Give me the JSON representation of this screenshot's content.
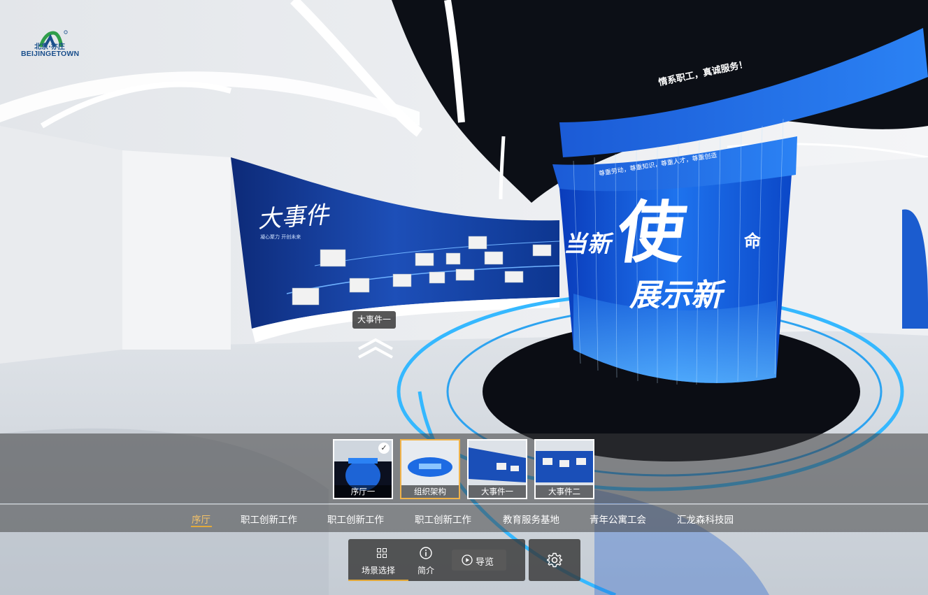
{
  "logo": {
    "cn_text": "北京·亦庄",
    "en_text": "BEIJINGETOWN",
    "icon": "beijing-etown-logo-icon"
  },
  "scene": {
    "poster_title": "大事件",
    "poster_subtitle": "凝心聚力  开创未来",
    "banner_top": "情系职工，真诚服务！",
    "banner_mid": "尊重劳动，尊重知识，尊重人才，尊重创造",
    "cylinder_line1": "当新",
    "cylinder_big": "使",
    "cylinder_small": "命",
    "cylinder_line2": "展示新"
  },
  "hotspot": {
    "label": "大事件一",
    "icon": "double-chevron-up-icon"
  },
  "thumbnails": [
    {
      "label": "序厅一",
      "selected": false,
      "checked": true
    },
    {
      "label": "组织架构",
      "selected": true,
      "checked": false
    },
    {
      "label": "大事件一",
      "selected": false,
      "checked": false
    },
    {
      "label": "大事件二",
      "selected": false,
      "checked": false
    }
  ],
  "tabs": [
    {
      "label": "序厅",
      "active": true
    },
    {
      "label": "职工创新工作",
      "active": false
    },
    {
      "label": "职工创新工作",
      "active": false
    },
    {
      "label": "职工创新工作",
      "active": false
    },
    {
      "label": "教育服务基地",
      "active": false
    },
    {
      "label": "青年公寓工会",
      "active": false
    },
    {
      "label": "汇龙森科技园",
      "active": false
    }
  ],
  "toolbar": {
    "scene_select": {
      "label": "场景选择",
      "icon": "grid-icon"
    },
    "intro": {
      "label": "简介",
      "icon": "info-icon"
    },
    "guide": {
      "label": "导览",
      "icon": "play-circle-icon"
    },
    "settings": {
      "icon": "gear-icon"
    }
  },
  "colors": {
    "accent": "#e2a93a",
    "active_tab": "#f3c168",
    "thumb_selected_border": "#f0b34a"
  }
}
